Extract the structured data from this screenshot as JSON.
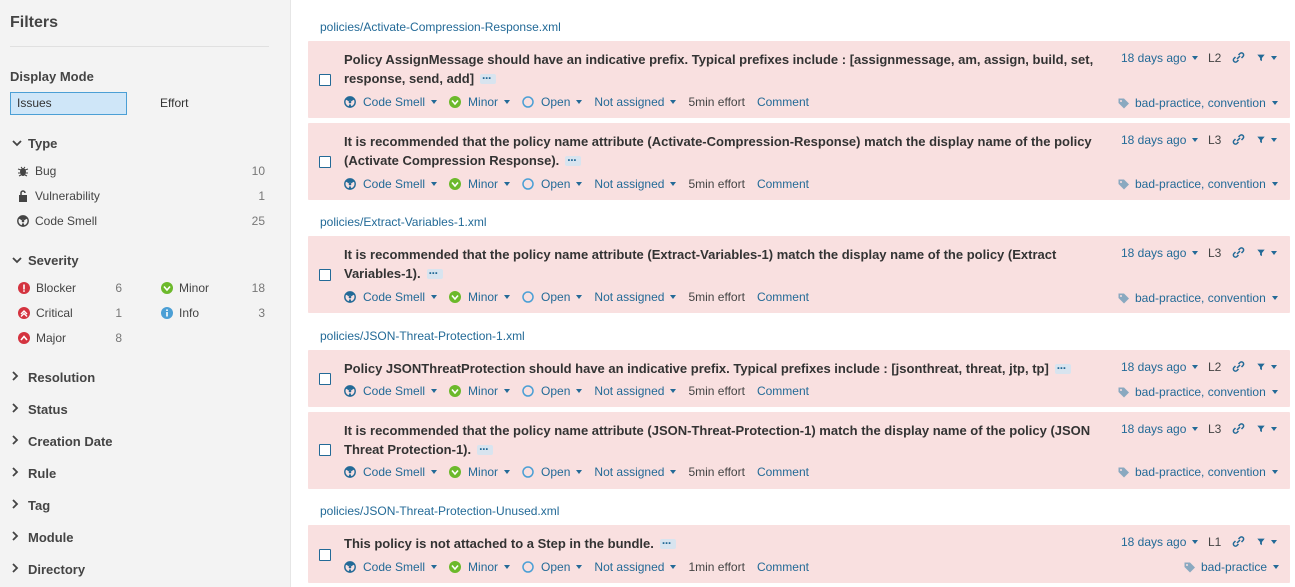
{
  "sidebar": {
    "title": "Filters",
    "display_mode_label": "Display Mode",
    "mode_issues": "Issues",
    "mode_effort": "Effort",
    "type": {
      "label": "Type",
      "items": [
        {
          "label": "Bug",
          "count": "10"
        },
        {
          "label": "Vulnerability",
          "count": "1"
        },
        {
          "label": "Code Smell",
          "count": "25"
        }
      ]
    },
    "severity": {
      "label": "Severity",
      "items": [
        {
          "label": "Blocker",
          "count": "6"
        },
        {
          "label": "Critical",
          "count": "1"
        },
        {
          "label": "Major",
          "count": "8"
        },
        {
          "label": "Minor",
          "count": "18"
        },
        {
          "label": "Info",
          "count": "3"
        }
      ]
    },
    "collapsed_facets": [
      "Resolution",
      "Status",
      "Creation Date",
      "Rule",
      "Tag",
      "Module",
      "Directory"
    ]
  },
  "components": [
    "policies/Activate-Compression-Response.xml",
    "policies/Extract-Variables-1.xml",
    "policies/JSON-Threat-Protection-1.xml",
    "policies/JSON-Threat-Protection-Unused.xml"
  ],
  "issues": [
    {
      "line1": "Policy AssignMessage should have an indicative prefix. Typical prefixes include : [assignmessage, am, assign, build, set,",
      "line2": "response, send, add]",
      "type": "Code Smell",
      "severity": "Minor",
      "status": "Open",
      "assignee": "Not assigned",
      "effort": "5min effort",
      "comment": "Comment",
      "ago": "18 days ago",
      "line": "L2",
      "tags": "bad-practice, convention"
    },
    {
      "line1": "It is recommended that the policy name attribute (Activate-Compression-Response) match the display name of the policy",
      "line2": "(Activate Compression Response).",
      "type": "Code Smell",
      "severity": "Minor",
      "status": "Open",
      "assignee": "Not assigned",
      "effort": "5min effort",
      "comment": "Comment",
      "ago": "18 days ago",
      "line": "L3",
      "tags": "bad-practice, convention"
    },
    {
      "line1": "It is recommended that the policy name attribute (Extract-Variables-1) match the display name of the policy (Extract",
      "line2": "Variables-1).",
      "type": "Code Smell",
      "severity": "Minor",
      "status": "Open",
      "assignee": "Not assigned",
      "effort": "5min effort",
      "comment": "Comment",
      "ago": "18 days ago",
      "line": "L3",
      "tags": "bad-practice, convention"
    },
    {
      "line1": "Policy JSONThreatProtection should have an indicative prefix. Typical prefixes include : [jsonthreat, threat, jtp, tp]",
      "line2": "",
      "type": "Code Smell",
      "severity": "Minor",
      "status": "Open",
      "assignee": "Not assigned",
      "effort": "5min effort",
      "comment": "Comment",
      "ago": "18 days ago",
      "line": "L2",
      "tags": "bad-practice, convention"
    },
    {
      "line1": "It is recommended that the policy name attribute (JSON-Threat-Protection-1) match the display name of the policy (JSON",
      "line2": "Threat Protection-1).",
      "type": "Code Smell",
      "severity": "Minor",
      "status": "Open",
      "assignee": "Not assigned",
      "effort": "5min effort",
      "comment": "Comment",
      "ago": "18 days ago",
      "line": "L3",
      "tags": "bad-practice, convention"
    },
    {
      "line1": "This policy is not attached to a Step in the bundle.",
      "line2": "",
      "type": "Code Smell",
      "severity": "Minor",
      "status": "Open",
      "assignee": "Not assigned",
      "effort": "1min effort",
      "comment": "Comment",
      "ago": "18 days ago",
      "line": "L1",
      "tags": "bad-practice"
    }
  ],
  "colors": {
    "link": "#236a97",
    "issue_bg": "#f9e0e0",
    "sidebar_bg": "#f3f3f3",
    "active_mode_bg": "#cfe6f8",
    "minor_green": "#6cb92b",
    "blocker_red": "#d4333f",
    "info_blue": "#4b9fd5"
  }
}
